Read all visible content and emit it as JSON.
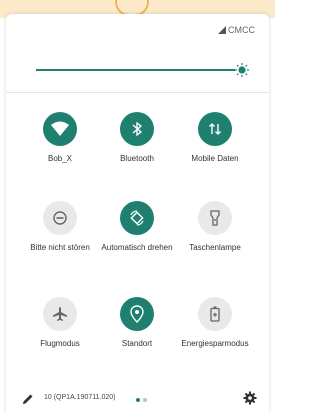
{
  "status_bar": {
    "carrier": "CMCC"
  },
  "brightness": {
    "level": 0.99
  },
  "tiles": [
    {
      "name": "wifi",
      "label": "Bob_X",
      "active": true,
      "icon": "wifi-icon"
    },
    {
      "name": "bluetooth",
      "label": "Bluetooth",
      "active": true,
      "icon": "bluetooth-icon"
    },
    {
      "name": "mobile-data",
      "label": "Mobile Daten",
      "active": true,
      "icon": "mobile-data-icon"
    },
    {
      "name": "dnd",
      "label": "Bitte nicht stören",
      "active": false,
      "icon": "do-not-disturb-icon"
    },
    {
      "name": "auto-rotate",
      "label": "Automatisch drehen",
      "active": true,
      "icon": "rotate-icon"
    },
    {
      "name": "flashlight",
      "label": "Taschenlampe",
      "active": false,
      "icon": "flashlight-icon"
    },
    {
      "name": "airplane",
      "label": "Flugmodus",
      "active": false,
      "icon": "airplane-icon"
    },
    {
      "name": "location",
      "label": "Standort",
      "active": true,
      "icon": "location-icon"
    },
    {
      "name": "battery-saver",
      "label": "Energiesparmodus",
      "active": false,
      "icon": "battery-saver-icon"
    }
  ],
  "footer": {
    "build": "10 (QP1A.190711.020)"
  },
  "colors": {
    "accent": "#1f8070",
    "inactive": "#e9e9e9"
  }
}
